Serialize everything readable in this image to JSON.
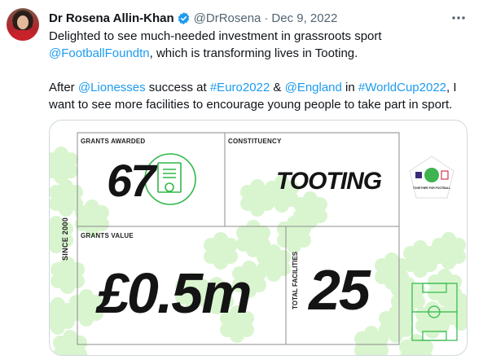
{
  "tweet": {
    "author_name": "Dr Rosena Allin-Khan",
    "handle": "@DrRosena",
    "separator": "·",
    "date": "Dec 9, 2022",
    "line1": "Delighted to see much-needed investment in grassroots sport",
    "line2_link": "@FootballFoundtn",
    "line2_rest": ", which is transforming lives in Tooting.",
    "line3_a": "After ",
    "line3_link1": "@Lionesses",
    "line3_b": " success at ",
    "line3_link2": "#Euro2022",
    "line3_c": " & ",
    "line3_link3": "@England",
    "line3_d": " in ",
    "line3_link4": "#WorldCup2022",
    "line3_e": ", I",
    "line4": "want to see more facilities to encourage young people to take part in sport."
  },
  "card": {
    "grants_awarded_label": "GRANTS AWARDED",
    "grants_awarded_value": "67",
    "constituency_label": "CONSTITUENCY",
    "constituency_value": "TOOTING",
    "grants_value_label": "GRANTS VALUE",
    "grants_value_value": "£0.5m",
    "since_label": "SINCE 2000",
    "total_facilities_label": "TOTAL FACILITIES",
    "total_facilities_value": "25",
    "badge_text": "TOGETHER FOR FOOTBALL"
  },
  "colors": {
    "link": "#1d9bf0",
    "muted": "#536471",
    "accent_green": "#2fb84a",
    "light_green": "#d9f5cf",
    "verified_blue": "#1d9bf0"
  },
  "icons": [
    "verified-badge-icon",
    "more-options-icon",
    "certificate-icon",
    "football-pitch-icon",
    "football-foundation-badge-icon"
  ]
}
